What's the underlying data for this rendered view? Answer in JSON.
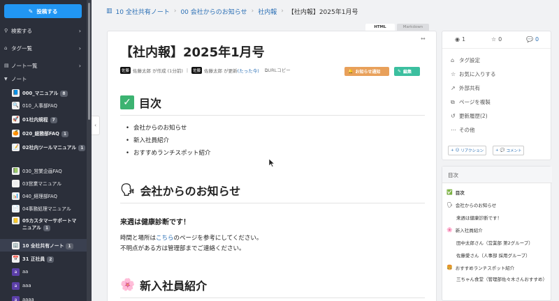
{
  "sidebar": {
    "post_button": "投稿する",
    "nav": [
      {
        "label": "検索する"
      },
      {
        "label": "タグ一覧"
      },
      {
        "label": "ノート一覧"
      }
    ],
    "section_label": "ノート",
    "tree": [
      {
        "label": "000_マニュアル",
        "badge": "8",
        "emoji": "📘",
        "bold": true
      },
      {
        "label": "010_人事部FAQ",
        "badge": "",
        "emoji": "🔍",
        "bold": false
      },
      {
        "label": "01社内規程",
        "badge": "7",
        "emoji": "🚀",
        "bold": true
      },
      {
        "label": "020_総務部FAQ",
        "badge": "1",
        "emoji": "🍊",
        "bold": true
      },
      {
        "label": "02社内ツールマニュアル",
        "badge": "1",
        "emoji": "📝",
        "bold": true
      },
      {
        "label": "030_営業企画FAQ",
        "badge": "",
        "emoji": "📗",
        "bold": false
      },
      {
        "label": "03営業マニュアル",
        "badge": "",
        "emoji": "⚙",
        "bold": false
      },
      {
        "label": "040_経理部FAQ",
        "badge": "",
        "emoji": "📊",
        "bold": false
      },
      {
        "label": "04事務処理マニュアル",
        "badge": "",
        "emoji": "📄",
        "bold": false
      },
      {
        "label": "05カスタマーサポートマ",
        "label2": "ニュアル",
        "badge": "1",
        "emoji": "📒",
        "bold": true
      },
      {
        "label": "10 全社共有ノート",
        "badge": "1",
        "emoji": "🏢",
        "bold": true,
        "active": true
      },
      {
        "label": "31 正社員",
        "badge": "2",
        "emoji": "📅",
        "bold": true
      },
      {
        "label": "aa",
        "badge": "",
        "emoji": "a",
        "bold": false,
        "purple": true
      },
      {
        "label": "aaa",
        "badge": "",
        "emoji": "a",
        "bold": false,
        "purple": true
      },
      {
        "label": "aaaa",
        "badge": "",
        "emoji": "a",
        "bold": false,
        "purple": true
      }
    ]
  },
  "breadcrumb": {
    "items": [
      "10 全社共有ノート",
      "00 会社からのお知らせ",
      "社内報"
    ],
    "current": "【社内報】2025年1月号"
  },
  "view_tabs": {
    "html": "HTML",
    "markdown": "Markdown"
  },
  "article": {
    "title": "【社内報】2025年1月号",
    "author_avatar": "佐藤",
    "created": "佐藤太郎 が作成 (1分前)",
    "updated_prefix": "佐藤太郎 が更新 ",
    "updated_link": "(たった今)",
    "copy_url": "URLコピー",
    "notify_button": "お知らせ通知",
    "edit_button": "編集",
    "toc_heading": "目次",
    "toc_items": [
      "会社からのお知らせ",
      "新入社員紹介",
      "おすすめランチスポット紹介"
    ],
    "section1_heading": "会社からのお知らせ",
    "section1_sub": "来週は健康診断です！",
    "section1_p1_pre": "時間と場所は",
    "section1_p1_link": "こちら",
    "section1_p1_post": "のページを参考にしてください。",
    "section1_p2": "不明点がある方は管理部までご連絡ください。",
    "section2_heading": "新入社員紹介"
  },
  "side_panel": {
    "views": "1",
    "stars": "0",
    "comments": "0",
    "items": [
      "タグ設定",
      "お気に入りする",
      "外部共有",
      "ページを複製",
      "更新履歴(2)",
      "その他"
    ],
    "reaction_button": "リアクション",
    "comment_button": "コメント"
  },
  "toc_panel": {
    "title": "目次",
    "items": [
      {
        "emoji": "✅",
        "label": "目次",
        "bold": true,
        "indent": 0
      },
      {
        "emoji": "🗣",
        "label": "会社からのお知らせ",
        "bold": false,
        "indent": 0
      },
      {
        "emoji": "",
        "label": "来週は健康診断です！",
        "bold": false,
        "indent": 1
      },
      {
        "emoji": "🌸",
        "label": "新入社員紹介",
        "bold": false,
        "indent": 0
      },
      {
        "emoji": "",
        "label": "田中太郎さん（営業部 第2グループ）",
        "bold": false,
        "indent": 1
      },
      {
        "emoji": "",
        "label": "佐藤愛さん（人事部 採用グループ）",
        "bold": false,
        "indent": 1
      },
      {
        "emoji": "🍔",
        "label": "おすすめランチスポット紹介",
        "bold": false,
        "indent": 0
      },
      {
        "emoji": "",
        "label": "三ちゃん食堂（管理部佐々木さんおすすめ）",
        "bold": false,
        "indent": 1
      }
    ]
  },
  "colors": {
    "primary": "#2196f3",
    "sidebar_bg": "#2b2f3a",
    "notify": "#e8a05a",
    "edit": "#3bbf9f",
    "link": "#2a6fb5"
  }
}
